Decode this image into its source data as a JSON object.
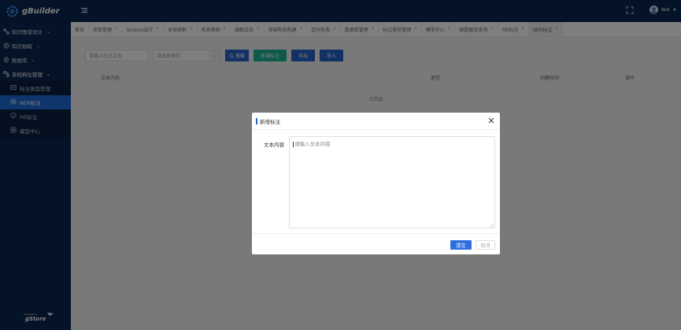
{
  "app": {
    "logo_text": "gBuilder"
  },
  "sidebar": {
    "menu": [
      {
        "label": "知识图谱设计",
        "icon": "graph-design-icon"
      },
      {
        "label": "知识抽取",
        "icon": "extract-icon"
      },
      {
        "label": "数据库",
        "icon": "database-icon"
      },
      {
        "label": "非结构化管理",
        "icon": "unstructured-icon"
      }
    ],
    "submenu": [
      {
        "label": "标注类型管理",
        "icon": "label-type-icon"
      },
      {
        "label": "NER标注",
        "icon": "ner-icon",
        "active": true
      },
      {
        "label": "RE标注",
        "icon": "re-icon"
      },
      {
        "label": "模型中心",
        "icon": "model-icon"
      }
    ],
    "powered_by": "Powered by gStore"
  },
  "header": {
    "user_name": "test"
  },
  "tabs": [
    {
      "label": "首页",
      "closable": false
    },
    {
      "label": "项目管理",
      "closable": true
    },
    {
      "label": "Schema设计",
      "closable": true
    },
    {
      "label": "关系映射",
      "closable": true
    },
    {
      "label": "关系映射",
      "closable": true
    },
    {
      "label": "抽取日志",
      "closable": true
    },
    {
      "label": "非结构化构建",
      "closable": true
    },
    {
      "label": "定时任务",
      "closable": true
    },
    {
      "label": "数据库管理",
      "closable": true
    },
    {
      "label": "标注类型管理",
      "closable": true
    },
    {
      "label": "模型中心",
      "closable": true
    },
    {
      "label": "图数据库查询",
      "closable": true
    },
    {
      "label": "RE标注",
      "closable": true
    },
    {
      "label": "NER标注",
      "closable": true,
      "active": true
    }
  ],
  "toolbar": {
    "search_placeholder": "请输入标注文本",
    "type_placeholder": "请选择类型",
    "search_label": "搜索",
    "add_label": "新增标注",
    "export_label": "导出",
    "import_label": "导入"
  },
  "table": {
    "columns": [
      "文本内容",
      "类型",
      "创建时间",
      "操作"
    ],
    "empty_text": "无数据"
  },
  "dialog": {
    "title": "新增标注",
    "field_label": "文本内容",
    "field_placeholder": "请输入文本内容",
    "submit_label": "提交",
    "cancel_label": "取消"
  },
  "colors": {
    "sidebar_bg": "#0b2750",
    "accent": "#2563c9",
    "active_menu": "#1d6cd8",
    "green": "#1ab394"
  }
}
